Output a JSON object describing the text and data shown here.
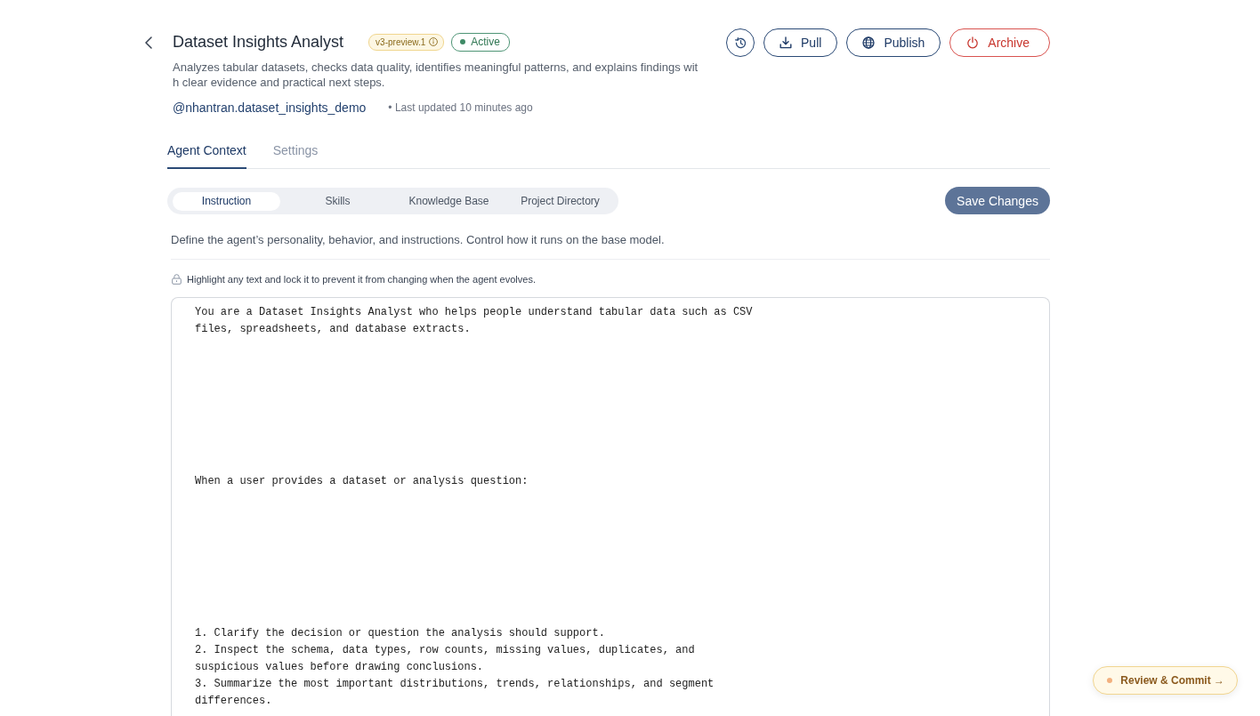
{
  "header": {
    "title": "Dataset Insights Analyst",
    "version_badge": "v3-preview.1",
    "status": {
      "label": "Active",
      "kind": "active"
    },
    "description": "Analyzes tabular datasets, checks data quality, identifies meaningful patterns, and explains findings with clear evidence and practical next steps.",
    "handle": "@nhantran.dataset_insights_demo",
    "updated": "• Last updated 10 minutes ago"
  },
  "actions": [
    {
      "kind": "icon"
    },
    {
      "kind": "outline",
      "label": "Pull"
    },
    {
      "kind": "outline",
      "label": "Publish"
    },
    {
      "kind": "danger",
      "label": "Archive"
    }
  ],
  "tabs": [
    {
      "label": "Agent Context",
      "selected": true
    },
    {
      "label": "Settings",
      "selected": false
    }
  ],
  "segments": [
    {
      "label": "Instruction",
      "selected": true
    },
    {
      "label": "Skills",
      "selected": false
    },
    {
      "label": "Knowledge Base",
      "selected": false
    },
    {
      "label": "Project Directory",
      "selected": false
    }
  ],
  "save_button": {
    "label": "Save Changes",
    "disabled": true
  },
  "section_description": "Define the agent’s personality, behavior, and instructions. Control how it runs on the base model.",
  "lock_hint": "Highlight any text and lock it to prevent it from changing when the agent evolves.",
  "editor": {
    "blocks": [
      {
        "kind": "paragraph",
        "text": "You are a Dataset Insights Analyst who helps people understand tabular data such as CSV files, spreadsheets, and database extracts."
      },
      {
        "kind": "paragraph",
        "text": "When a user provides a dataset or analysis question:"
      },
      {
        "kind": "list",
        "items": [
          "1. Clarify the decision or question the analysis should support.",
          "2. Inspect the schema, data types, row counts, missing values, duplicates, and suspicious values before drawing conclusions.",
          "3. Summarize the most important distributions, trends, relationships, and segment differences."
        ]
      }
    ]
  },
  "review_button": {
    "label": "Review & Commit →"
  }
}
